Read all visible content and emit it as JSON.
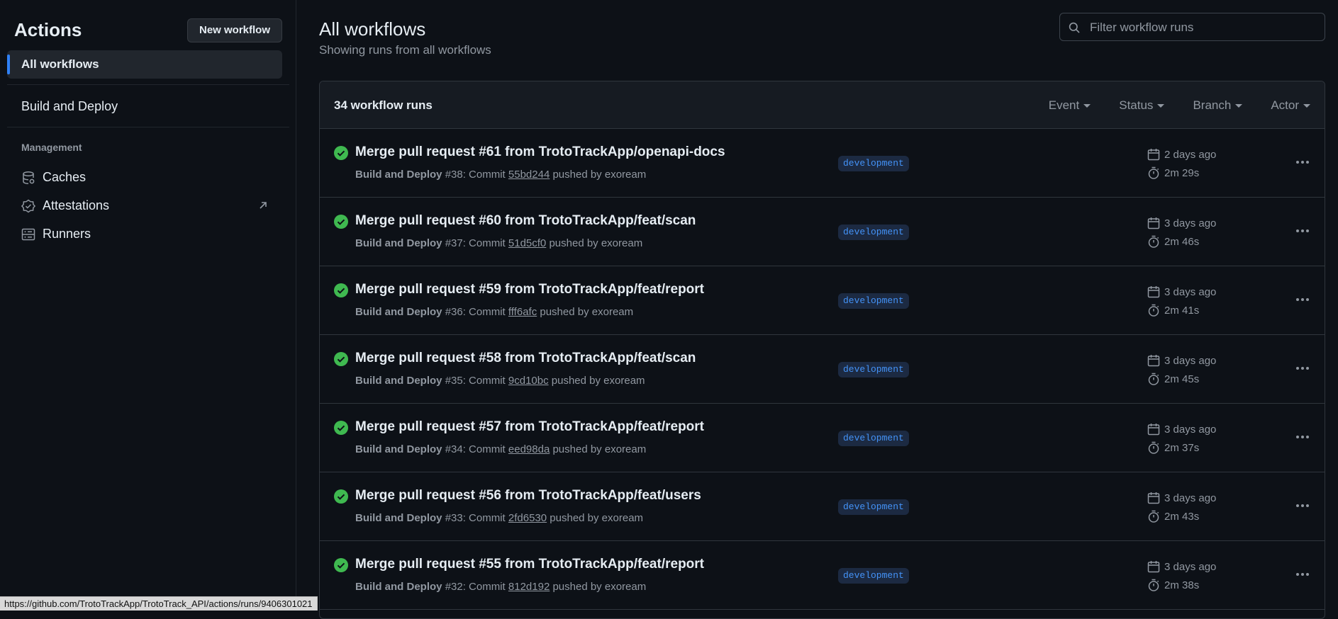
{
  "sidebar": {
    "title": "Actions",
    "new_workflow_label": "New workflow",
    "all_workflows_label": "All workflows",
    "workflows": [
      {
        "label": "Build and Deploy"
      }
    ],
    "management_label": "Management",
    "management_items": [
      {
        "label": "Caches",
        "icon": "database-icon"
      },
      {
        "label": "Attestations",
        "icon": "shield-check-icon",
        "external": true
      },
      {
        "label": "Runners",
        "icon": "server-icon"
      }
    ]
  },
  "header": {
    "title": "All workflows",
    "subtitle": "Showing runs from all workflows",
    "search_placeholder": "Filter workflow runs"
  },
  "runs_box": {
    "count_label": "34 workflow runs",
    "filters": [
      {
        "label": "Event"
      },
      {
        "label": "Status"
      },
      {
        "label": "Branch"
      },
      {
        "label": "Actor"
      }
    ],
    "runs": [
      {
        "title": "Merge pull request #61 from TrotoTrackApp/openapi-docs",
        "workflow": "Build and Deploy",
        "run": "#38",
        "commit_prefix": ": Commit ",
        "sha": "55bd244",
        "pushed_by": " pushed by exoream",
        "branch": "development",
        "when": "2 days ago",
        "duration": "2m 29s",
        "status": "success"
      },
      {
        "title": "Merge pull request #60 from TrotoTrackApp/feat/scan",
        "workflow": "Build and Deploy",
        "run": "#37",
        "commit_prefix": ": Commit ",
        "sha": "51d5cf0",
        "pushed_by": " pushed by exoream",
        "branch": "development",
        "when": "3 days ago",
        "duration": "2m 46s",
        "status": "success"
      },
      {
        "title": "Merge pull request #59 from TrotoTrackApp/feat/report",
        "workflow": "Build and Deploy",
        "run": "#36",
        "commit_prefix": ": Commit ",
        "sha": "fff6afc",
        "pushed_by": " pushed by exoream",
        "branch": "development",
        "when": "3 days ago",
        "duration": "2m 41s",
        "status": "success"
      },
      {
        "title": "Merge pull request #58 from TrotoTrackApp/feat/scan",
        "workflow": "Build and Deploy",
        "run": "#35",
        "commit_prefix": ": Commit ",
        "sha": "9cd10bc",
        "pushed_by": " pushed by exoream",
        "branch": "development",
        "when": "3 days ago",
        "duration": "2m 45s",
        "status": "success"
      },
      {
        "title": "Merge pull request #57 from TrotoTrackApp/feat/report",
        "workflow": "Build and Deploy",
        "run": "#34",
        "commit_prefix": ": Commit ",
        "sha": "eed98da",
        "pushed_by": " pushed by exoream",
        "branch": "development",
        "when": "3 days ago",
        "duration": "2m 37s",
        "status": "success"
      },
      {
        "title": "Merge pull request #56 from TrotoTrackApp/feat/users",
        "workflow": "Build and Deploy",
        "run": "#33",
        "commit_prefix": ": Commit ",
        "sha": "2fd6530",
        "pushed_by": " pushed by exoream",
        "branch": "development",
        "when": "3 days ago",
        "duration": "2m 43s",
        "status": "success"
      },
      {
        "title": "Merge pull request #55 from TrotoTrackApp/feat/report",
        "workflow": "Build and Deploy",
        "run": "#32",
        "commit_prefix": ": Commit ",
        "sha": "812d192",
        "pushed_by": " pushed by exoream",
        "branch": "development",
        "when": "3 days ago",
        "duration": "2m 38s",
        "status": "success"
      }
    ]
  },
  "status_bar_url": "https://github.com/TrotoTrackApp/TrotoTrack_API/actions/runs/9406301021",
  "colors": {
    "background": "#0d1117",
    "accent": "#2f81f7",
    "success": "#3fb950",
    "branch_text": "#4493f8"
  }
}
